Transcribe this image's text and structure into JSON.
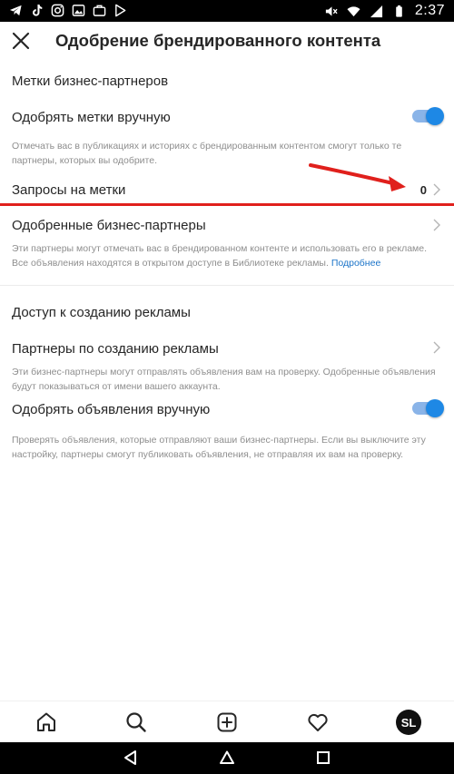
{
  "status_bar": {
    "time": "2:37",
    "left_icons": [
      "telegram-icon",
      "tiktok-icon",
      "instagram-icon",
      "photo-icon",
      "briefcase-icon",
      "play-store-icon"
    ],
    "right_icons": [
      "mute-icon",
      "wifi-icon",
      "signal-icon",
      "battery-icon"
    ]
  },
  "header": {
    "title": "Одобрение брендированного контента"
  },
  "sections": {
    "business_partner_tags": {
      "title": "Метки бизнес-партнеров",
      "approve_manually": {
        "label": "Одобрять метки вручную",
        "enabled": true,
        "description": "Отмечать вас в публикациях и историях с брендированным контентом смогут только те партнеры, которых вы одобрите."
      },
      "tag_requests": {
        "label": "Запросы на метки",
        "count": "0"
      },
      "approved_partners": {
        "label": "Одобренные бизнес-партнеры",
        "description": "Эти партнеры могут отмечать вас в брендированном контенте и использовать его в рекламе. Все объявления находятся в открытом доступе в Библиотеке рекламы.",
        "link": "Подробнее"
      }
    },
    "ad_creation_access": {
      "title": "Доступ к созданию рекламы",
      "ad_partners": {
        "label": "Партнеры по созданию рекламы",
        "description": "Эти бизнес-партнеры могут отправлять объявления вам на проверку. Одобренные объявления будут показываться от имени вашего аккаунта."
      },
      "approve_ads_manually": {
        "label": "Одобрять объявления вручную",
        "enabled": true,
        "description": "Проверять объявления, которые отправляют ваши бизнес-партнеры. Если вы выключите эту настройку, партнеры смогут публиковать объявления, не отправляя их вам на проверку."
      }
    }
  },
  "tab_bar": {
    "items": [
      "home-icon",
      "search-icon",
      "create-icon",
      "activity-icon",
      "profile-avatar"
    ],
    "avatar_initials": "SL"
  },
  "nav_bar": {
    "items": [
      "back-icon",
      "home-nav-icon",
      "recents-icon"
    ]
  },
  "colors": {
    "accent": "#1e88e5",
    "toggle_track": "#8ab4e8",
    "link": "#1a73c8",
    "annotation_red": "#e0201c",
    "secondary_text": "#8e8e8e"
  }
}
